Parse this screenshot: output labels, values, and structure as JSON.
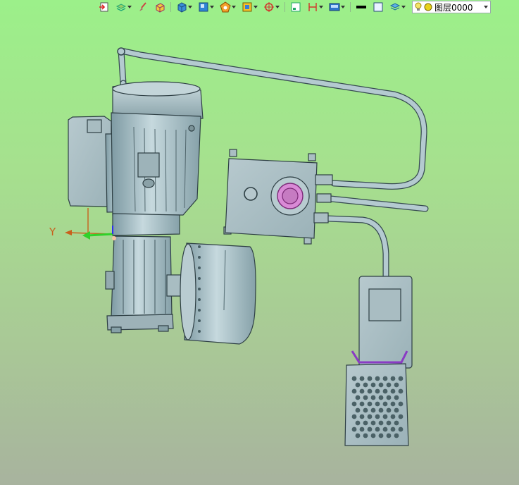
{
  "toolbar": {
    "buttons": [
      {
        "name": "import-icon",
        "has_dropdown": false
      },
      {
        "name": "layers-stack-icon",
        "has_dropdown": true
      },
      {
        "name": "brush-icon",
        "has_dropdown": false
      },
      {
        "name": "solid-box-icon",
        "has_dropdown": false
      },
      {
        "name": "shaded-cube-icon",
        "has_dropdown": true
      },
      {
        "name": "view-cube-icon",
        "has_dropdown": true
      },
      {
        "name": "render-mode-icon",
        "has_dropdown": true
      },
      {
        "name": "section-view-icon",
        "has_dropdown": true
      },
      {
        "name": "snap-target-icon",
        "has_dropdown": true
      },
      {
        "name": "frame-icon",
        "has_dropdown": false
      },
      {
        "name": "dimension-icon",
        "has_dropdown": true
      },
      {
        "name": "display-settings-icon",
        "has_dropdown": true
      },
      {
        "name": "line-color-icon",
        "has_dropdown": false
      },
      {
        "name": "fill-color-icon",
        "has_dropdown": false
      },
      {
        "name": "layer-manager-icon",
        "has_dropdown": true
      }
    ],
    "layer": {
      "name": "图层0000",
      "bulb_color": "#f3e46a",
      "dot_color": "#e8d21c"
    }
  },
  "viewport": {
    "background_top": "#9cf08a",
    "background_bottom": "#a8b39e",
    "axis_label": "Y",
    "axis_colors": {
      "y_arrow": "#c8601c",
      "x_arrow": "#2fd12a"
    }
  }
}
